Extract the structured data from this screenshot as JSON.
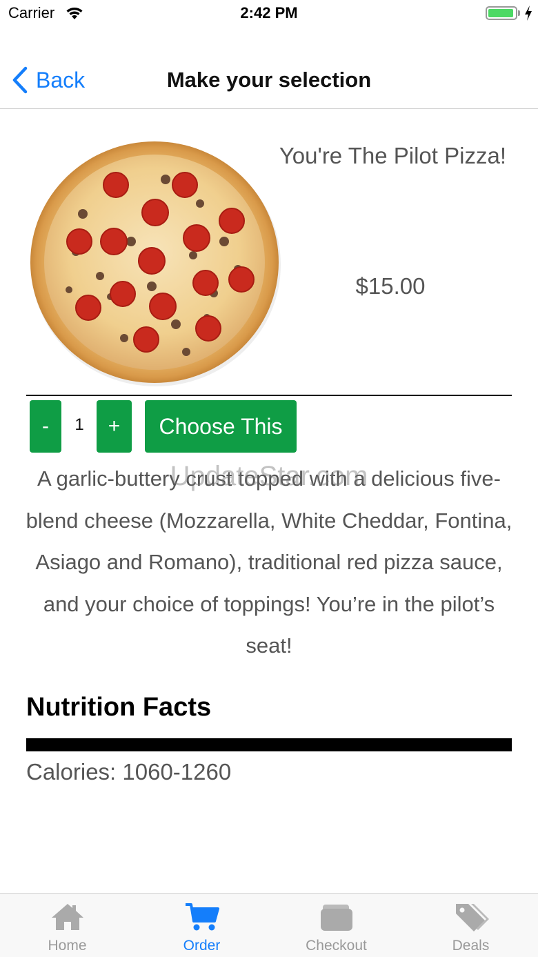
{
  "status_bar": {
    "carrier": "Carrier",
    "time": "2:42 PM",
    "battery_color": "#4cd964"
  },
  "nav": {
    "back_label": "Back",
    "title": "Make your selection"
  },
  "product": {
    "name": "You're The Pilot Pizza!",
    "price": "$15.00",
    "image_icon": "pepperoni-pizza-photo",
    "quantity": "1",
    "minus_label": "-",
    "plus_label": "+",
    "choose_label": "Choose This",
    "description": "A garlic-buttery crust topped with a delicious five-blend cheese (Mozzarella, White Cheddar, Fontina, Asiago and Romano), traditional red pizza sauce, and your choice of toppings! You’re in the pilot’s seat!",
    "watermark": "UpdateStar.com"
  },
  "nutrition": {
    "title": "Nutrition Facts",
    "calories": "Calories: 1060-1260"
  },
  "tabs": [
    {
      "label": "Home",
      "icon": "home-icon",
      "active": false
    },
    {
      "label": "Order",
      "icon": "cart-icon",
      "active": true
    },
    {
      "label": "Checkout",
      "icon": "wallet-icon",
      "active": false
    },
    {
      "label": "Deals",
      "icon": "tags-icon",
      "active": false
    }
  ],
  "colors": {
    "accent": "#147efb",
    "button_green": "#0f9d45",
    "inactive_tab": "#999999"
  }
}
